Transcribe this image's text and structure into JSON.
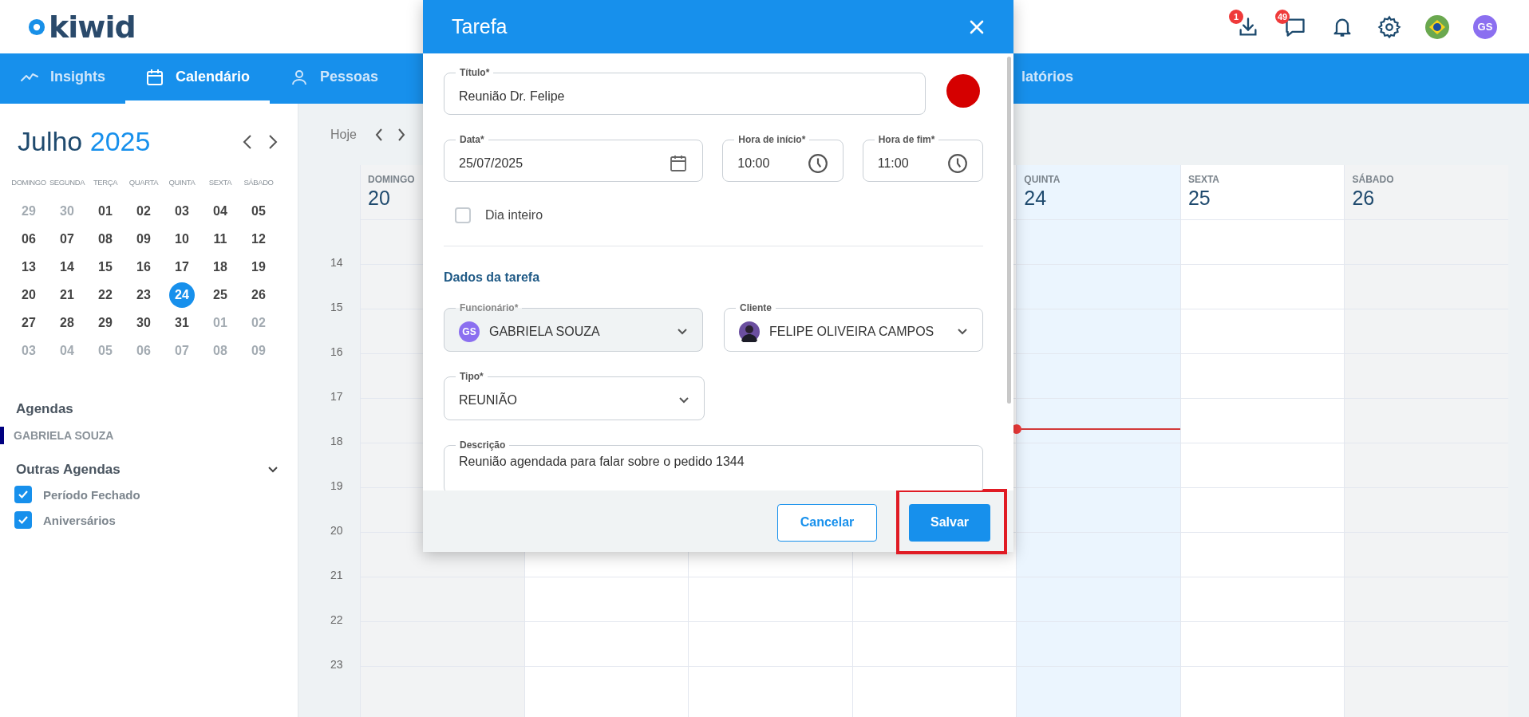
{
  "header": {
    "logo": "kiwid",
    "actions": [
      {
        "kind": "download",
        "badge": "1"
      },
      {
        "kind": "chat",
        "badge": "49"
      },
      {
        "kind": "bell"
      },
      {
        "kind": "settings"
      },
      {
        "kind": "flag"
      },
      {
        "kind": "avatar",
        "text": "GS"
      }
    ]
  },
  "nav": [
    {
      "label": "Insights",
      "kind": "chart",
      "selected": false
    },
    {
      "label": "Calendário",
      "kind": "calendar",
      "selected": true
    },
    {
      "label": "Pessoas",
      "kind": "person",
      "selected": false
    },
    {
      "label": "latórios",
      "kind": "plain",
      "selected": false
    }
  ],
  "mini_calendar": {
    "month": "Julho",
    "year": "2025",
    "weekdays": [
      "DOMINGO",
      "SEGUNDA",
      "TERÇA",
      "QUARTA",
      "QUINTA",
      "SEXTA",
      "SÁBADO"
    ],
    "weeks": [
      [
        {
          "day": "29",
          "outside": true,
          "selected": false
        },
        {
          "day": "30",
          "outside": true,
          "selected": false
        },
        {
          "day": "01",
          "outside": false,
          "selected": false
        },
        {
          "day": "02",
          "outside": false,
          "selected": false
        },
        {
          "day": "03",
          "outside": false,
          "selected": false
        },
        {
          "day": "04",
          "outside": false,
          "selected": false
        },
        {
          "day": "05",
          "outside": false,
          "selected": false
        }
      ],
      [
        {
          "day": "06",
          "outside": false,
          "selected": false
        },
        {
          "day": "07",
          "outside": false,
          "selected": false
        },
        {
          "day": "08",
          "outside": false,
          "selected": false
        },
        {
          "day": "09",
          "outside": false,
          "selected": false
        },
        {
          "day": "10",
          "outside": false,
          "selected": false
        },
        {
          "day": "11",
          "outside": false,
          "selected": false
        },
        {
          "day": "12",
          "outside": false,
          "selected": false
        }
      ],
      [
        {
          "day": "13",
          "outside": false,
          "selected": false
        },
        {
          "day": "14",
          "outside": false,
          "selected": false
        },
        {
          "day": "15",
          "outside": false,
          "selected": false
        },
        {
          "day": "16",
          "outside": false,
          "selected": false
        },
        {
          "day": "17",
          "outside": false,
          "selected": false
        },
        {
          "day": "18",
          "outside": false,
          "selected": false
        },
        {
          "day": "19",
          "outside": false,
          "selected": false
        }
      ],
      [
        {
          "day": "20",
          "outside": false,
          "selected": false
        },
        {
          "day": "21",
          "outside": false,
          "selected": false
        },
        {
          "day": "22",
          "outside": false,
          "selected": false
        },
        {
          "day": "23",
          "outside": false,
          "selected": false
        },
        {
          "day": "24",
          "outside": false,
          "selected": true
        },
        {
          "day": "25",
          "outside": false,
          "selected": false
        },
        {
          "day": "26",
          "outside": false,
          "selected": false
        }
      ],
      [
        {
          "day": "27",
          "outside": false,
          "selected": false
        },
        {
          "day": "28",
          "outside": false,
          "selected": false
        },
        {
          "day": "29",
          "outside": false,
          "selected": false
        },
        {
          "day": "30",
          "outside": false,
          "selected": false
        },
        {
          "day": "31",
          "outside": false,
          "selected": false
        },
        {
          "day": "01",
          "outside": true,
          "selected": false
        },
        {
          "day": "02",
          "outside": true,
          "selected": false
        }
      ],
      [
        {
          "day": "03",
          "outside": true,
          "selected": false
        },
        {
          "day": "04",
          "outside": true,
          "selected": false
        },
        {
          "day": "05",
          "outside": true,
          "selected": false
        },
        {
          "day": "06",
          "outside": true,
          "selected": false
        },
        {
          "day": "07",
          "outside": true,
          "selected": false
        },
        {
          "day": "08",
          "outside": true,
          "selected": false
        },
        {
          "day": "09",
          "outside": true,
          "selected": false
        }
      ]
    ]
  },
  "agendas": {
    "title": "Agendas",
    "items": [
      {
        "name": "GABRIELA SOUZA",
        "color": "#000080"
      }
    ]
  },
  "other_agendas": {
    "title": "Outras Agendas",
    "expanded": true,
    "items": [
      {
        "label": "Período Fechado",
        "checked": true
      },
      {
        "label": "Aniversários",
        "checked": true
      }
    ]
  },
  "toolbar": {
    "today": "Hoje"
  },
  "week": {
    "days": [
      {
        "weekday": "DOMINGO",
        "date": "20",
        "today": false,
        "weekend": true
      },
      {
        "today": false,
        "weekend": false
      },
      {
        "today": false,
        "weekend": false
      },
      {
        "today": false,
        "weekend": false
      },
      {
        "weekday": "QUINTA",
        "date": "24",
        "today": true,
        "weekend": false
      },
      {
        "weekday": "SEXTA",
        "date": "25",
        "today": false,
        "weekend": false
      },
      {
        "weekday": "SÁBADO",
        "date": "26",
        "today": false,
        "weekend": true
      }
    ],
    "hours": [
      "14",
      "15",
      "16",
      "17",
      "18",
      "19",
      "20",
      "21",
      "22",
      "23"
    ]
  },
  "modal": {
    "title": "Tarefa",
    "title_field": {
      "label": "Título*",
      "value": "Reunião Dr. Felipe"
    },
    "color": "#d50000",
    "date_field": {
      "label": "Data*",
      "value": "25/07/2025"
    },
    "start_field": {
      "label": "Hora de início*",
      "value": "10:00"
    },
    "end_field": {
      "label": "Hora de fim*",
      "value": "11:00"
    },
    "all_day": {
      "label": "Dia inteiro",
      "checked": false
    },
    "section": "Dados da tarefa",
    "employee_field": {
      "label": "Funcionário*",
      "avatar": "GS",
      "value": "GABRIELA SOUZA",
      "disabled": true
    },
    "client_field": {
      "label": "Cliente",
      "value": "FELIPE OLIVEIRA CAMPOS",
      "disabled": false
    },
    "type_field": {
      "label": "Tipo*",
      "value": "REUNIÃO"
    },
    "description_field": {
      "label": "Descrição",
      "value": "Reunião agendada para falar sobre o pedido 1344"
    },
    "buttons": [
      {
        "label": "Cancelar",
        "kind": "secondary",
        "highlighted": false
      },
      {
        "label": "Salvar",
        "kind": "primary",
        "highlighted": true
      }
    ]
  }
}
